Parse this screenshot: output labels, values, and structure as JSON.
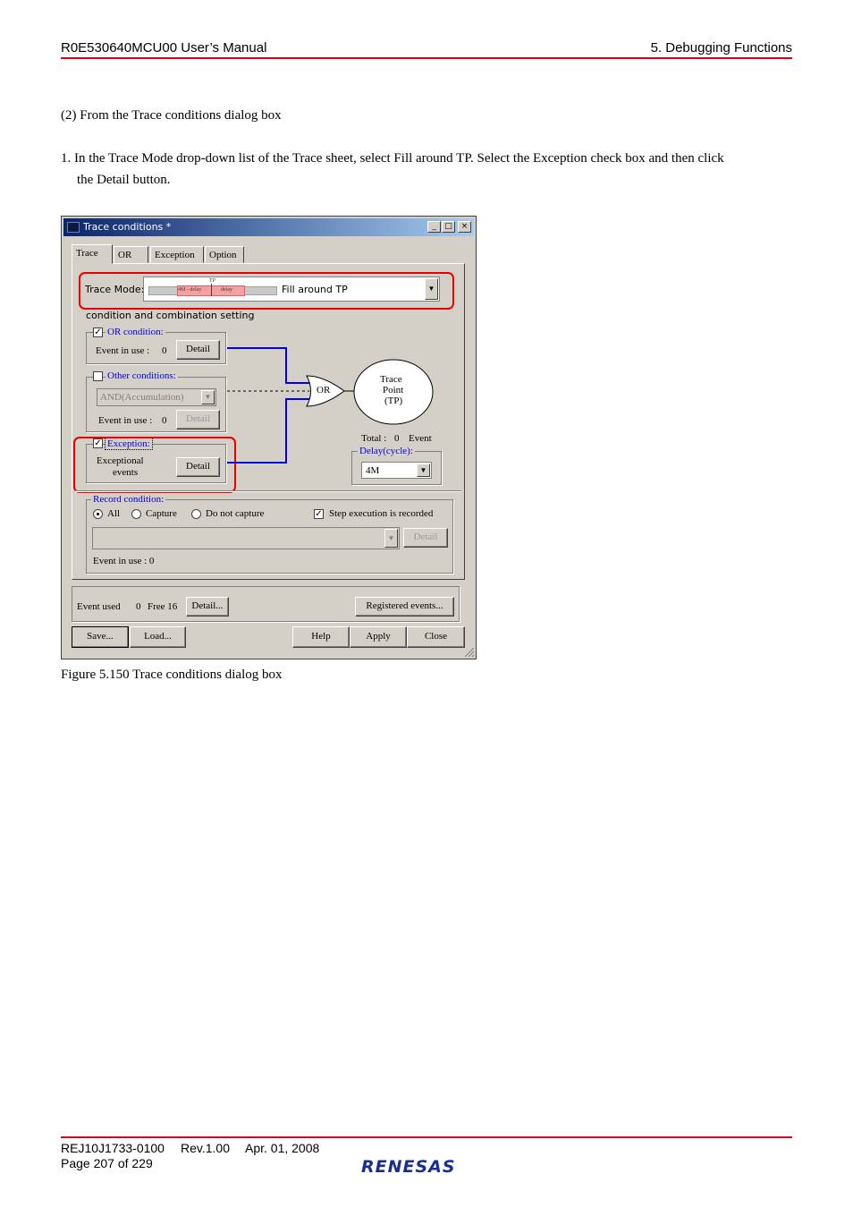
{
  "header": {
    "left": "R0E530640MCU00 User’s Manual",
    "right": "5. Debugging Functions"
  },
  "body": {
    "para1": "(2) From the Trace conditions dialog box",
    "para2_line1": "1. In the Trace Mode drop-down list of the Trace sheet, select Fill around TP. Select the Exception check box and then click",
    "para2_line2": "the Detail button."
  },
  "dialog": {
    "title": "Trace conditions *",
    "title_buttons": {
      "minimize": "_",
      "maximize": "□",
      "close": "×"
    },
    "tabs": [
      "Trace",
      "OR",
      "Exception",
      "Option"
    ],
    "trace_mode": {
      "label": "Trace Mode:",
      "value": "Fill around TP",
      "bar_tp": "TP",
      "bar_left": "4M - delay",
      "bar_right": "delay"
    },
    "condition_heading": "condition and combination setting",
    "or_condition": {
      "label": "OR condition:",
      "checked": true,
      "event_label": "Event in use :",
      "event_count": "0",
      "detail": "Detail"
    },
    "other_conditions": {
      "label": "Other conditions:",
      "checked": false,
      "combo": "AND(Accumulation)",
      "event_label": "Event in use :",
      "event_count": "0",
      "detail": "Detail"
    },
    "exception": {
      "label": "Exception:",
      "checked": true,
      "text_line1": "Exceptional",
      "text_line2": "events",
      "detail": "Detail"
    },
    "or_gate": "OR",
    "trace_point": {
      "line1": "Trace",
      "line2": "Point",
      "line3": "(TP)"
    },
    "total": {
      "label": "Total :",
      "count": "0",
      "unit": "Event"
    },
    "delay": {
      "label": "Delay(cycle):",
      "value": "4M"
    },
    "record": {
      "label": "Record condition:",
      "options": [
        "All",
        "Capture",
        "Do not capture"
      ],
      "selected": "All",
      "step_label": "Step execution is recorded",
      "step_checked": true,
      "detail": "Detail",
      "event_label": "Event in use : 0"
    },
    "event_bar": {
      "used_label": "Event used",
      "used": "0",
      "free": "Free 16",
      "detail": "Detail...",
      "registered": "Registered events..."
    },
    "buttons": {
      "save": "Save...",
      "load": "Load...",
      "help": "Help",
      "apply": "Apply",
      "close": "Close"
    }
  },
  "caption": "Figure 5.150 Trace conditions dialog box",
  "footer": {
    "doc_id": "REJ10J1733-0100",
    "rev": "Rev.1.00",
    "date": "Apr. 01, 2008",
    "page": "Page 207 of 229",
    "logo": "RENESAS"
  },
  "colors": {
    "rule": "#d8001a",
    "highlight": "#e80000",
    "wire": "#0000e0",
    "titlebar": "#0a246a"
  }
}
